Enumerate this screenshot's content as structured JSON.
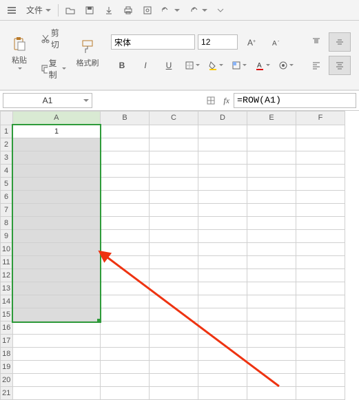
{
  "menu": {
    "file_label": "文件"
  },
  "clipboard": {
    "paste_label": "粘贴",
    "cut_label": "剪切",
    "copy_label": "复制",
    "format_painter_label": "格式刷"
  },
  "font": {
    "name": "宋体",
    "size": "12"
  },
  "namebox": {
    "ref": "A1"
  },
  "formula": {
    "fx_label": "fx",
    "value": "=ROW(A1)"
  },
  "columns": [
    "A",
    "B",
    "C",
    "D",
    "E",
    "F"
  ],
  "rows": [
    "1",
    "2",
    "3",
    "4",
    "5",
    "6",
    "7",
    "8",
    "9",
    "10",
    "11",
    "12",
    "13",
    "14",
    "15",
    "16",
    "17",
    "18",
    "19",
    "20",
    "21"
  ],
  "cells": {
    "A1": "1"
  },
  "chart_data": {
    "type": "table",
    "selection": "A1:A15",
    "active_cell": "A1",
    "formula": "=ROW(A1)",
    "computed": {
      "A1": 1
    }
  }
}
